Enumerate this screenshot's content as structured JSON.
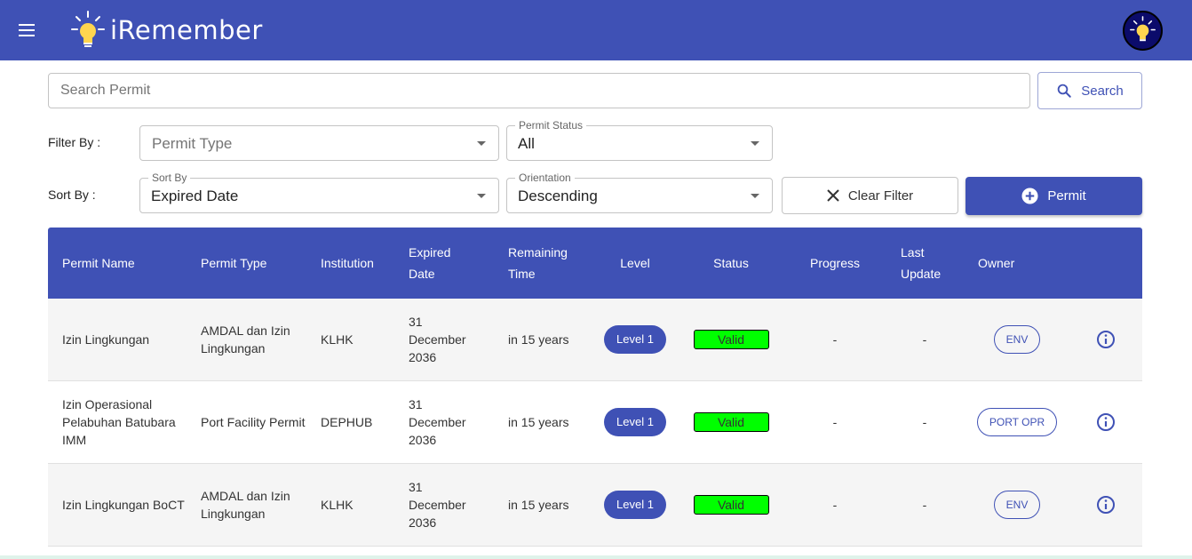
{
  "app": {
    "title": "iRemember"
  },
  "search": {
    "placeholder": "Search Permit",
    "button_label": "Search"
  },
  "filter": {
    "label": "Filter By :",
    "permit_type": {
      "placeholder": "Permit Type"
    },
    "permit_status": {
      "legend": "Permit Status",
      "value": "All"
    }
  },
  "sort": {
    "label": "Sort By :",
    "sort_by": {
      "legend": "Sort By",
      "value": "Expired Date"
    },
    "orientation": {
      "legend": "Orientation",
      "value": "Descending"
    }
  },
  "actions": {
    "clear_label": "Clear Filter",
    "add_label": "Permit"
  },
  "table": {
    "headers": {
      "name": "Permit Name",
      "type": "Permit Type",
      "institution": "Institution",
      "expired": "Expired Date",
      "remaining": "Remaining Time",
      "level": "Level",
      "status": "Status",
      "progress": "Progress",
      "update": "Last Update",
      "owner": "Owner"
    },
    "rows": [
      {
        "name": "Izin Lingkungan",
        "type": "AMDAL dan Izin Lingkungan",
        "institution": "KLHK",
        "expired": "31 December 2036",
        "remaining": "in 15 years",
        "level": "Level 1",
        "status": "Valid",
        "progress": "-",
        "update": "-",
        "owner": "ENV"
      },
      {
        "name": "Izin Operasional Pelabuhan Batubara IMM",
        "type": "Port Facility Permit",
        "institution": "DEPHUB",
        "expired": "31 December 2036",
        "remaining": "in 15 years",
        "level": "Level 1",
        "status": "Valid",
        "progress": "-",
        "update": "-",
        "owner": "PORT OPR"
      },
      {
        "name": "Izin Lingkungan BoCT",
        "type": "AMDAL dan Izin Lingkungan",
        "institution": "KLHK",
        "expired": "31 December 2036",
        "remaining": "in 15 years",
        "level": "Level 1",
        "status": "Valid",
        "progress": "-",
        "update": "-",
        "owner": "ENV"
      }
    ]
  },
  "colors": {
    "primary": "#3f51b5",
    "valid": "#00ff00",
    "row_alt": "#f5f5f5"
  },
  "icons": {
    "menu": "menu-icon",
    "logo": "lightbulb-icon",
    "search": "search-icon",
    "close": "close-icon",
    "add": "add-circle-icon",
    "info": "info-icon"
  }
}
